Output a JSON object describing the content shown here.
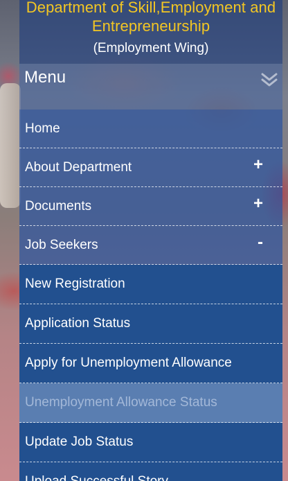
{
  "header": {
    "title": "Department of Skill,Employment and Entrepreneurship",
    "subtitle": "(Employment Wing)"
  },
  "menu": {
    "title": "Menu",
    "toggle_icon": "double-chevron-down-icon",
    "items": [
      {
        "label": "Home",
        "sign": ""
      },
      {
        "label": "About Department",
        "sign": "+"
      },
      {
        "label": "Documents",
        "sign": "+"
      },
      {
        "label": "Job Seekers",
        "sign": "-"
      }
    ],
    "sub_items": [
      {
        "label": "New Registration"
      },
      {
        "label": "Application Status"
      },
      {
        "label": "Apply for Unemployment Allowance"
      },
      {
        "label": "Unemployment Allowance Status"
      },
      {
        "label": "Update Job Status"
      },
      {
        "label": "Upload Successful Story"
      }
    ]
  },
  "colors": {
    "header_title": "#f3c623",
    "submenu_bg": "#22508f",
    "submenu_active_bg": "#5a7eb1"
  }
}
